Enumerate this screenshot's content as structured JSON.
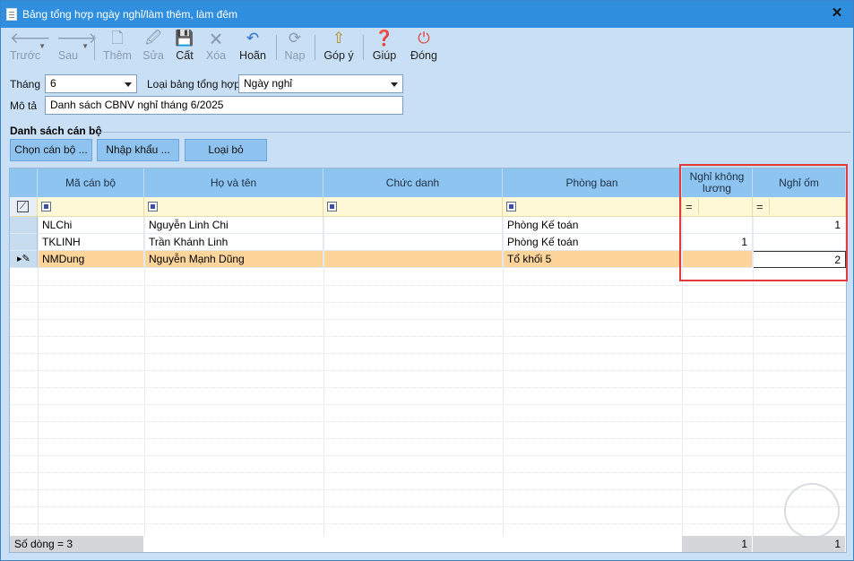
{
  "window": {
    "title": "Bảng tổng hợp ngày nghỉ/làm thêm, làm đêm",
    "close_label": "✕"
  },
  "toolbar": {
    "back": {
      "label": "Trước",
      "icon": "arrow-left-icon"
    },
    "forward": {
      "label": "Sau",
      "icon": "arrow-right-icon"
    },
    "add": {
      "label": "Thêm",
      "icon": "new-document-icon"
    },
    "edit": {
      "label": "Sửa",
      "icon": "edit-document-icon"
    },
    "save": {
      "label": "Cất",
      "icon": "floppy-disk-icon"
    },
    "delete": {
      "label": "Xóa",
      "icon": "delete-document-icon"
    },
    "undo": {
      "label": "Hoãn",
      "icon": "undo-icon"
    },
    "reload": {
      "label": "Nạp",
      "icon": "refresh-icon"
    },
    "feedback": {
      "label": "Góp ý",
      "icon": "feedback-icon"
    },
    "help": {
      "label": "Giúp",
      "icon": "help-icon"
    },
    "close": {
      "label": "Đóng",
      "icon": "power-icon"
    }
  },
  "form": {
    "month_label": "Tháng",
    "month_value": "6",
    "report_type_label": "Loại bảng tổng hợp",
    "report_type_value": "Ngày nghỉ",
    "description_label": "Mô tả",
    "description_value": "Danh sách CBNV nghỉ tháng 6/2025"
  },
  "group": {
    "title": "Danh sách cán bộ",
    "buttons": {
      "choose": "Chọn cán bộ ...",
      "import": "Nhập khẩu ...",
      "remove": "Loại bỏ"
    }
  },
  "grid": {
    "columns": [
      "Mã cán bộ",
      "Họ và tên",
      "Chức danh",
      "Phòng ban",
      "Nghỉ không lương",
      "Nghỉ ốm"
    ],
    "rows": [
      {
        "code": "NLChi",
        "name": "Nguyễn Linh Chi",
        "title": "",
        "dept": "Phòng Kế toán",
        "unpaid": "",
        "sick": "1"
      },
      {
        "code": "TKLINH",
        "name": "Trần Khánh Linh",
        "title": "",
        "dept": "Phòng Kế toán",
        "unpaid": "1",
        "sick": ""
      },
      {
        "code": "NMDung",
        "name": "Nguyễn Mạnh Dũng",
        "title": "",
        "dept": "Tổ khối 5",
        "unpaid": "",
        "sick": "2"
      }
    ],
    "footer": {
      "row_count": "Số dòng = 3",
      "unpaid_total": "1",
      "sick_total": "1"
    }
  },
  "colors": {
    "titlebar": "#2f8fde",
    "header": "#8ec4f0",
    "selected_row": "#fdd59b",
    "highlight_box": "#e23a3a"
  }
}
